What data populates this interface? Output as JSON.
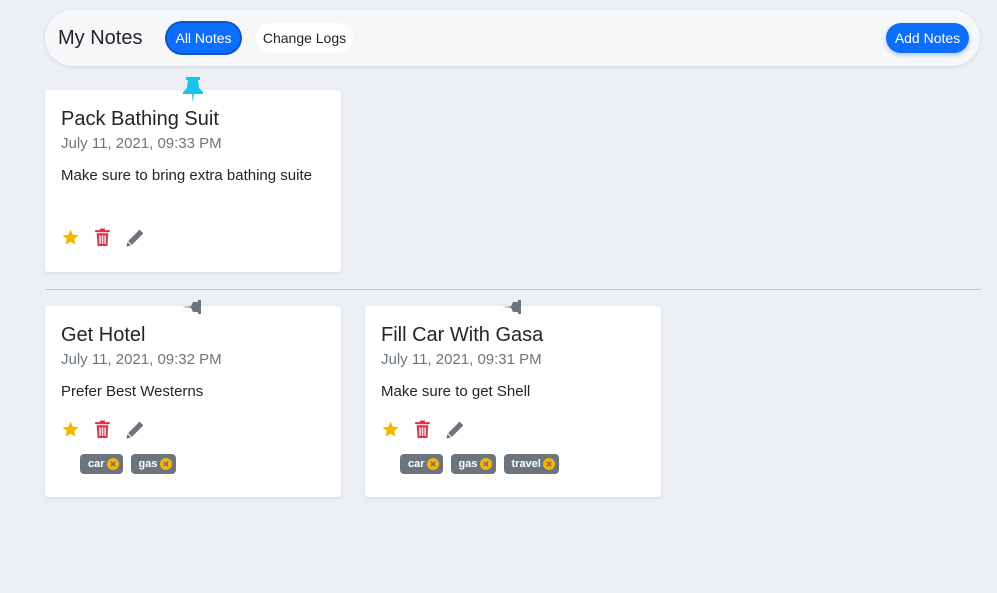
{
  "navbar": {
    "brand": "My Notes",
    "all_notes_label": "All Notes",
    "change_logs_label": "Change Logs",
    "add_notes_label": "Add Notes"
  },
  "colors": {
    "primary": "#0d6efd",
    "pinned_color": "#1ac3ec",
    "unpinned_color": "#6c757d",
    "star": "#f7b500",
    "trash": "#dc3545",
    "edit": "#6c757d",
    "tag_bg": "#6c757d",
    "tag_close": "#f7b500"
  },
  "pinned_notes": [
    {
      "title": "Pack Bathing Suit",
      "date": "July 11, 2021, 09:33 PM",
      "body": "Make sure to bring extra bathing suite",
      "pinned": true,
      "tags": []
    }
  ],
  "notes": [
    {
      "title": "Get Hotel",
      "date": "July 11, 2021, 09:32 PM",
      "body": "Prefer Best Westerns",
      "pinned": false,
      "tags": [
        "car",
        "gas"
      ]
    },
    {
      "title": "Fill Car With Gasa",
      "date": "July 11, 2021, 09:31 PM",
      "body": "Make sure to get Shell",
      "pinned": false,
      "tags": [
        "car",
        "gas",
        "travel"
      ]
    }
  ]
}
